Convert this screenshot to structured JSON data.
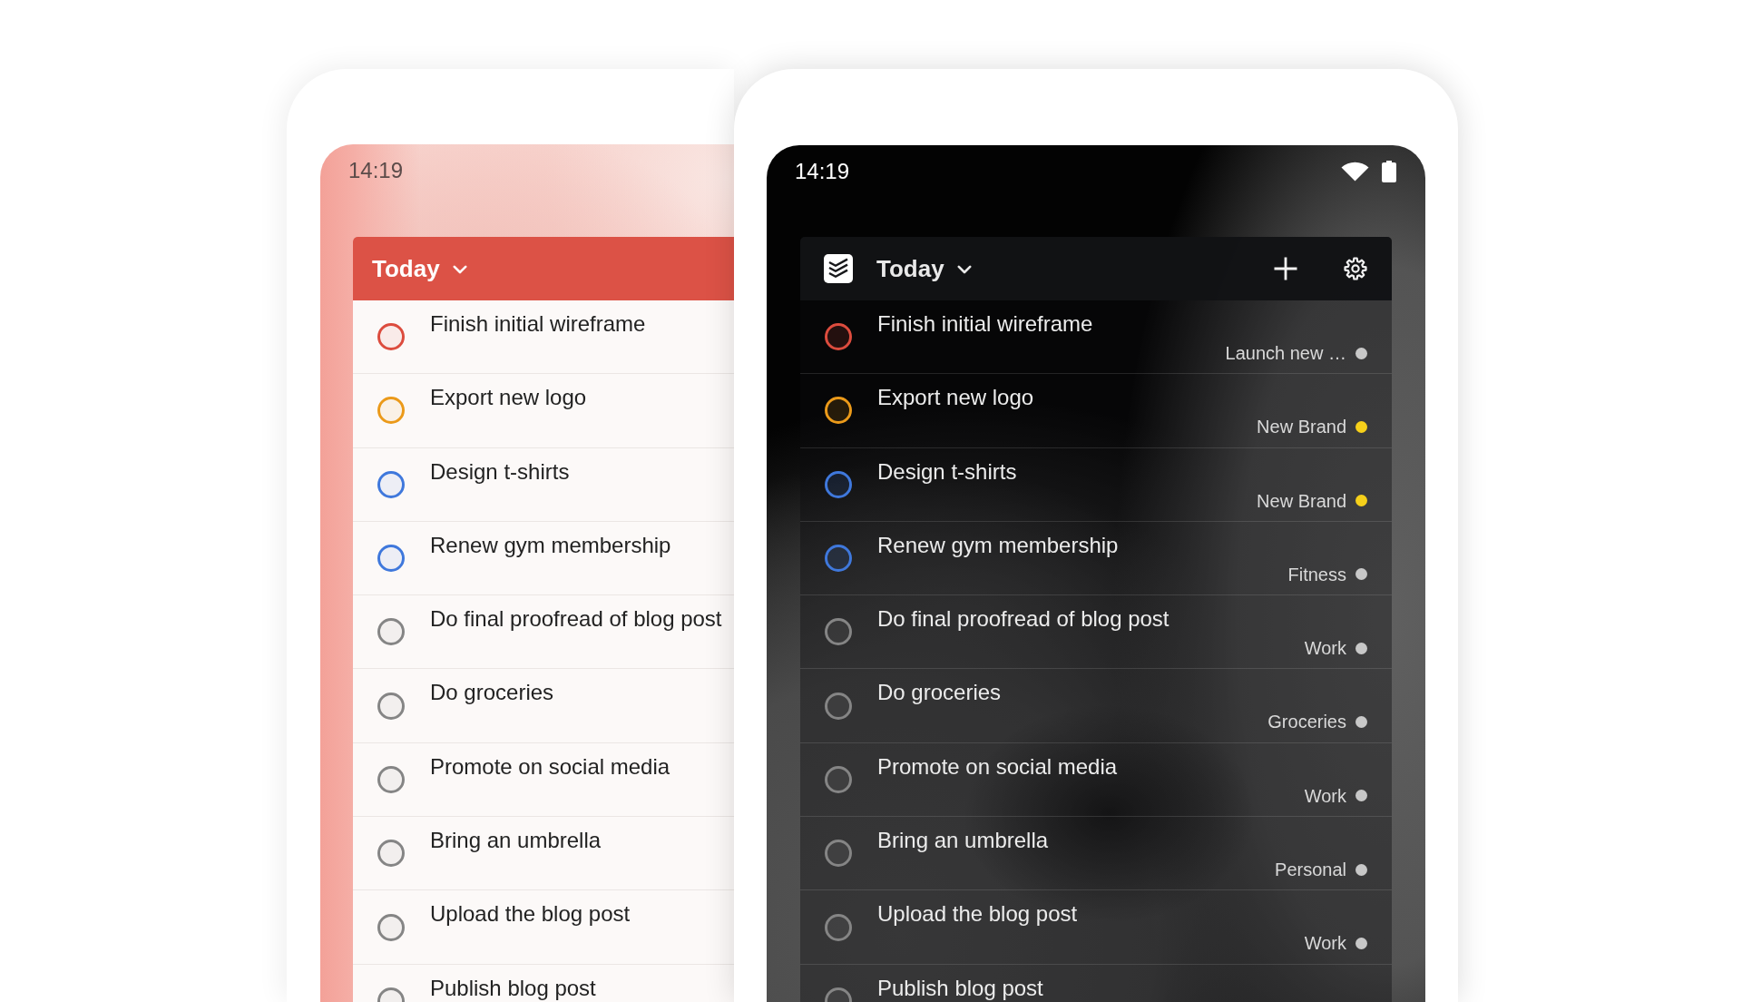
{
  "phones": [
    {
      "kind": "light",
      "status_bar": {
        "time": "14:19"
      },
      "widget": {
        "title": "Today",
        "tasks": [
          {
            "title": "Finish initial wireframe",
            "color": "#dc4c3e"
          },
          {
            "title": "Export new logo",
            "color": "#eb9a1a"
          },
          {
            "title": "Design t-shirts",
            "color": "#3f78dc"
          },
          {
            "title": "Renew gym membership",
            "color": "#3f78dc"
          },
          {
            "title": "Do final proofread of blog post",
            "color": "#858585"
          },
          {
            "title": "Do groceries",
            "color": "#858585"
          },
          {
            "title": "Promote on social media",
            "color": "#858585"
          },
          {
            "title": "Bring an umbrella",
            "color": "#858585"
          },
          {
            "title": "Upload the blog post",
            "color": "#858585"
          },
          {
            "title": "Publish blog post",
            "color": "#858585"
          }
        ]
      }
    },
    {
      "kind": "dark",
      "status_bar": {
        "time": "14:19"
      },
      "widget": {
        "title": "Today",
        "tasks": [
          {
            "title": "Finish initial wireframe",
            "color": "#dc4c3e",
            "project": {
              "name": "Launch new …",
              "color": "#c8c8c8"
            }
          },
          {
            "title": "Export new logo",
            "color": "#eb9a1a",
            "project": {
              "name": "New Brand",
              "color": "#f6d01a"
            }
          },
          {
            "title": "Design t-shirts",
            "color": "#3f78dc",
            "project": {
              "name": "New Brand",
              "color": "#f6d01a"
            }
          },
          {
            "title": "Renew gym membership",
            "color": "#3f78dc",
            "project": {
              "name": "Fitness",
              "color": "#c8c8c8"
            }
          },
          {
            "title": "Do final proofread of blog post",
            "color": "#858585",
            "project": {
              "name": "Work",
              "color": "#c8c8c8"
            }
          },
          {
            "title": "Do groceries",
            "color": "#858585",
            "project": {
              "name": "Groceries",
              "color": "#c8c8c8"
            }
          },
          {
            "title": "Promote on social media",
            "color": "#858585",
            "project": {
              "name": "Work",
              "color": "#c8c8c8"
            }
          },
          {
            "title": "Bring an umbrella",
            "color": "#858585",
            "project": {
              "name": "Personal",
              "color": "#c8c8c8"
            }
          },
          {
            "title": "Upload the blog post",
            "color": "#858585",
            "project": {
              "name": "Work",
              "color": "#c8c8c8"
            }
          },
          {
            "title": "Publish blog post",
            "color": "#858585"
          }
        ]
      }
    }
  ]
}
